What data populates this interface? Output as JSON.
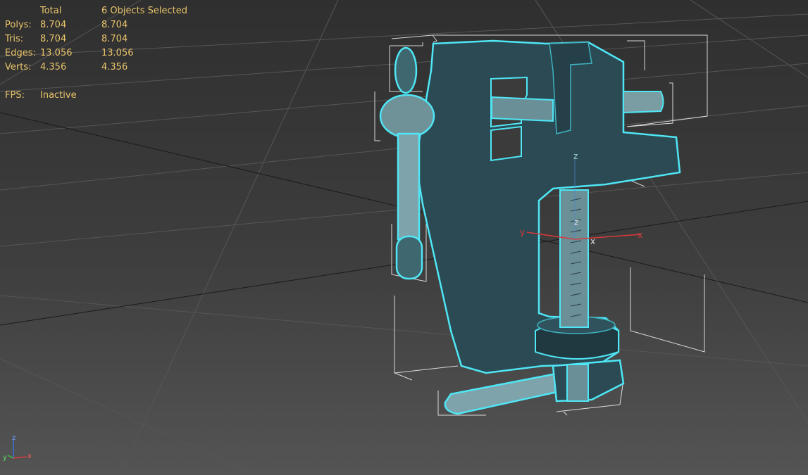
{
  "stats": {
    "header": {
      "label": "",
      "total": "Total",
      "selected": "6 Objects Selected"
    },
    "polys": {
      "label": "Polys:",
      "total": "8.704",
      "selected": "8.704"
    },
    "tris": {
      "label": "Tris:",
      "total": "8.704",
      "selected": "8.704"
    },
    "edges": {
      "label": "Edges:",
      "total": "13.056",
      "selected": "13.056"
    },
    "verts": {
      "label": "Verts:",
      "total": "4.356",
      "selected": "4.356"
    },
    "fps": {
      "label": "FPS:",
      "value": "Inactive"
    }
  },
  "pivot_axes": {
    "x": "x",
    "y": "y",
    "z": "z"
  },
  "gizmo_axes": {
    "x": "x",
    "y": "y",
    "z": "z"
  },
  "colors": {
    "stats_text": "#e9c46a",
    "selection_outline": "#4fe6f5",
    "model_fill": "#2a4b55",
    "grid_line": "#5a5a5a",
    "axis_x": "#d83a3a",
    "axis_y": "#3fbf3f",
    "axis_z": "#3a6ed8"
  }
}
